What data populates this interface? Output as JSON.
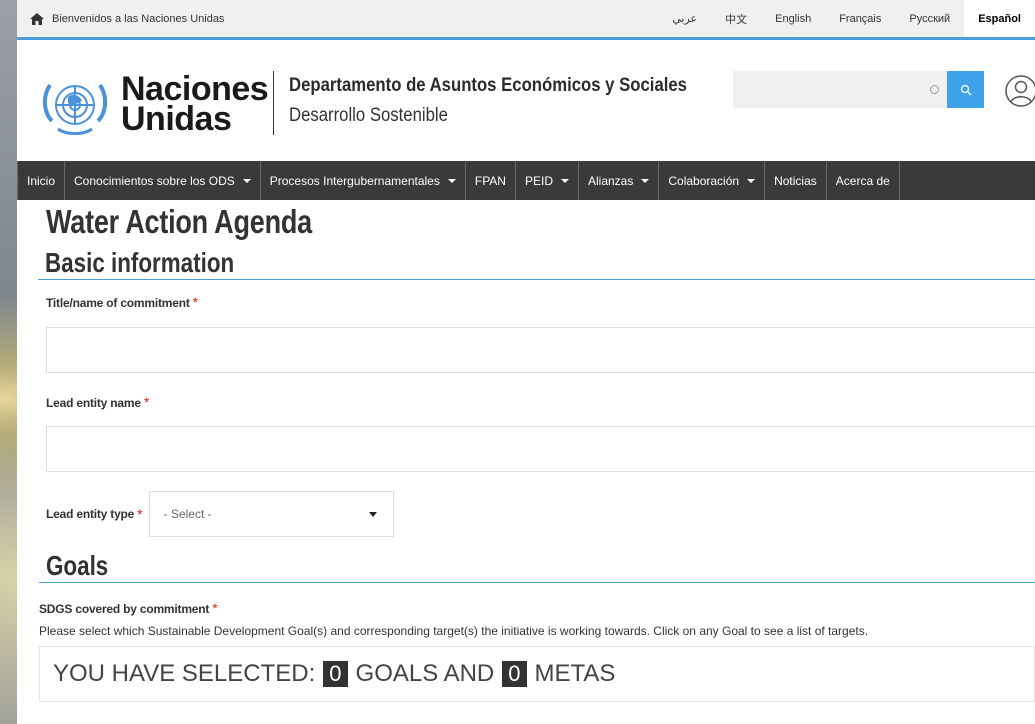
{
  "topbar": {
    "welcome": "Bienvenidos a las Naciones Unidas",
    "languages": [
      "عربي",
      "中文",
      "English",
      "Français",
      "Русский",
      "Español"
    ],
    "active_language": "Español"
  },
  "header": {
    "logo_line1": "Naciones",
    "logo_line2": "Unidas",
    "dept_title": "Departamento de Asuntos Económicos y Sociales",
    "dept_subtitle": "Desarrollo Sostenible",
    "search_value": ""
  },
  "nav": {
    "items": [
      {
        "label": "Inicio",
        "dropdown": false
      },
      {
        "label": "Conocimientos sobre los ODS",
        "dropdown": true
      },
      {
        "label": "Procesos Intergubernamentales",
        "dropdown": true
      },
      {
        "label": "FPAN",
        "dropdown": false
      },
      {
        "label": "PEID",
        "dropdown": true
      },
      {
        "label": "Alianzas",
        "dropdown": true
      },
      {
        "label": "Colaboración",
        "dropdown": true
      },
      {
        "label": "Noticias",
        "dropdown": false
      },
      {
        "label": "Acerca de",
        "dropdown": false
      }
    ]
  },
  "main": {
    "page_title": "Water Action Agenda",
    "section_basic": "Basic information",
    "title_label": "Title/name of commitment",
    "title_value": "",
    "lead_name_label": "Lead entity name",
    "lead_name_value": "",
    "lead_type_label": "Lead entity type",
    "lead_type_selected": "- Select -",
    "required_mark": "*",
    "section_goals": "Goals",
    "sdgs_label": "SDGS covered by commitment",
    "sdgs_help": "Please select which Sustainable Development Goal(s) and corresponding target(s) the initiative is working towards. Click on any Goal to see a list of targets.",
    "selected_prefix": "YOU HAVE SELECTED:",
    "goals_count": "0",
    "goals_word": "GOALS AND",
    "metas_count": "0",
    "metas_word": "METAS"
  },
  "colors": {
    "accent_blue": "#3ea3e8",
    "nav_bg": "#3a3a3a",
    "required_red": "#e0201b"
  }
}
